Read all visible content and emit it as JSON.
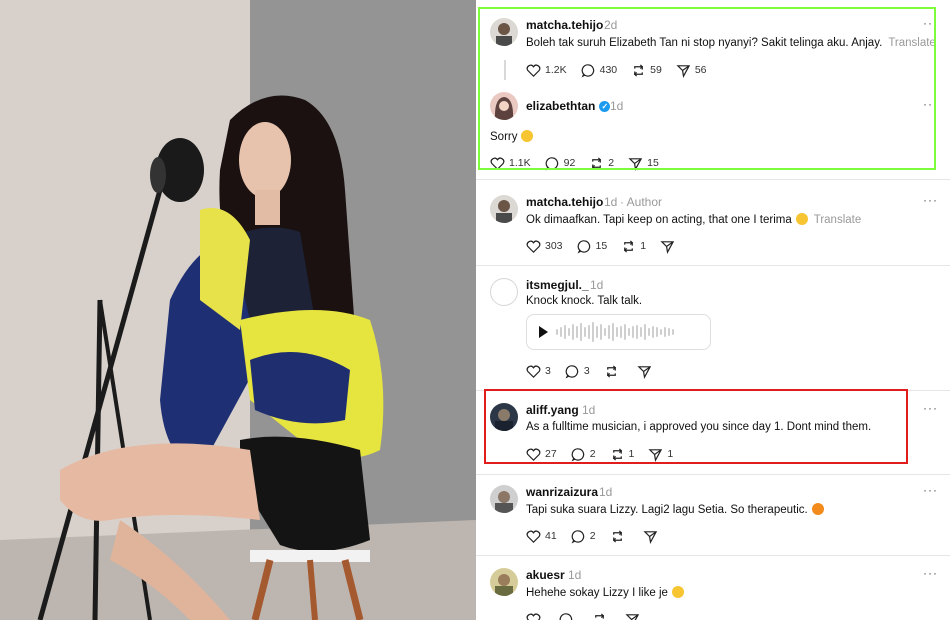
{
  "photo": {
    "description_icon": "woman-singing-microphone-photo"
  },
  "posts": [
    {
      "username": "matcha.tehijo",
      "time": "2d",
      "text": "Boleh tak suruh Elizabeth Tan ni stop nyanyi? Sakit telinga aku. Anjay.",
      "translate": "Translate",
      "likes": "1.2K",
      "replies": "430",
      "reposts": "59",
      "shares": "56"
    },
    {
      "username": "elizabethtan",
      "time": "1d",
      "text": "Sorry",
      "likes": "1.1K",
      "replies": "92",
      "reposts": "2",
      "shares": "15"
    },
    {
      "username": "matcha.tehijo",
      "time": "1d",
      "author_tag": "· Author",
      "text": "Ok dimaafkan. Tapi keep on acting, that one I terima",
      "translate": "Translate",
      "likes": "303",
      "replies": "15",
      "reposts": "1"
    },
    {
      "username": "itsmegjul._",
      "time": "1d",
      "text": "Knock knock. Talk talk.",
      "likes": "3",
      "replies": "3"
    },
    {
      "username": "aliff.yang",
      "time": "1d",
      "text": "As a fulltime musician, i approved you since day 1. Dont mind them.",
      "likes": "27",
      "replies": "2",
      "reposts": "1",
      "shares": "1"
    },
    {
      "username": "wanrizaizura",
      "time": "1d",
      "text": "Tapi suka suara Lizzy. Lagi2 lagu Setia. So therapeutic.",
      "likes": "41",
      "replies": "2"
    },
    {
      "username": "akuesr",
      "time": "1d",
      "text": "Hehehe sokay Lizzy I like je"
    }
  ],
  "more_label": "···",
  "verified_mark": "✓",
  "colors": {
    "highlight_green": "#7CFC3A",
    "highlight_red": "#e01c1c",
    "verified_blue": "#1d9bf0"
  }
}
